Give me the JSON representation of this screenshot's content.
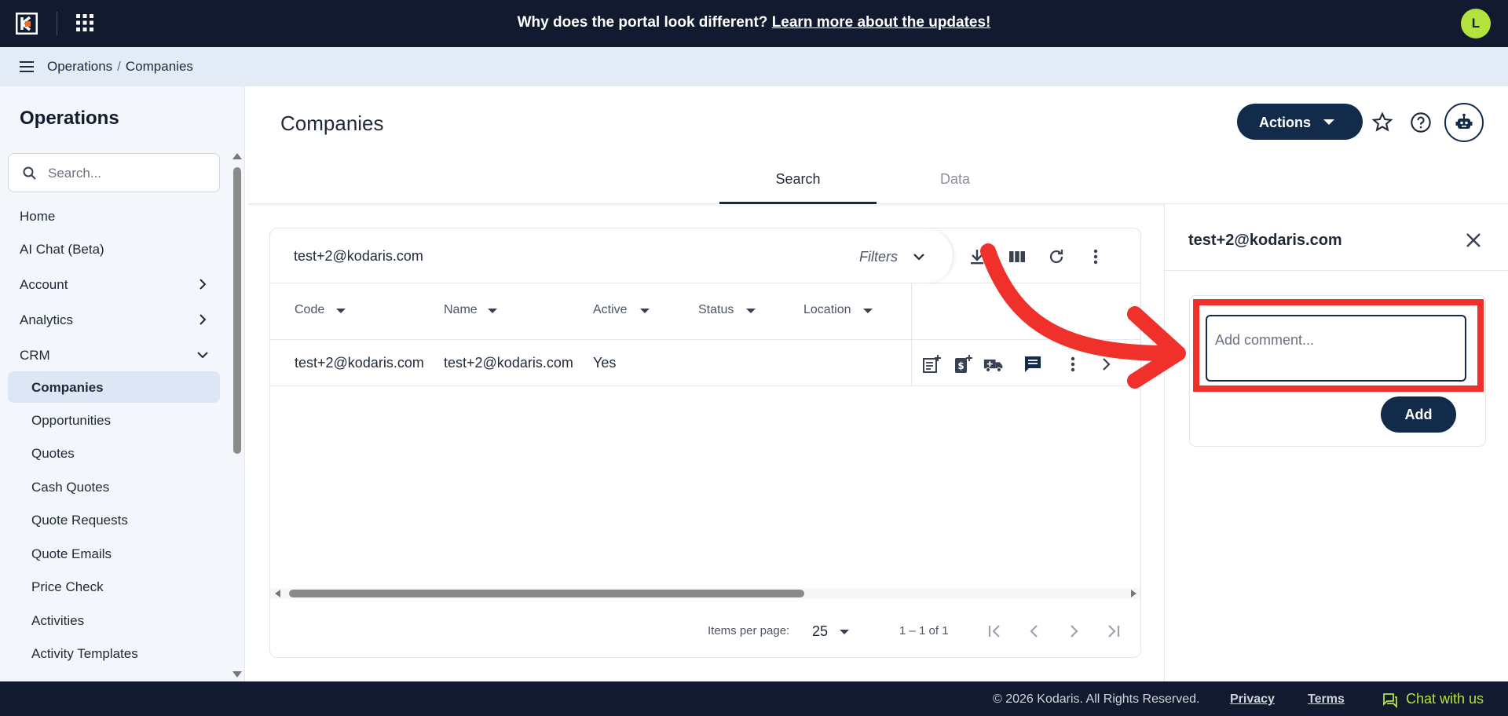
{
  "topbar": {
    "banner_text": "Why does the portal look different?",
    "banner_link": "Learn more about the updates!",
    "avatar_initial": "L"
  },
  "breadcrumb": {
    "items": [
      "Operations",
      "Companies"
    ]
  },
  "sidebar": {
    "title": "Operations",
    "search_placeholder": "Search...",
    "items": [
      {
        "label": "Home",
        "type": "top"
      },
      {
        "label": "AI Chat (Beta)",
        "type": "top"
      },
      {
        "label": "Account",
        "type": "group",
        "expanded": false
      },
      {
        "label": "Analytics",
        "type": "group",
        "expanded": false
      },
      {
        "label": "CRM",
        "type": "group",
        "expanded": true
      },
      {
        "label": "Companies",
        "type": "sub",
        "active": true
      },
      {
        "label": "Opportunities",
        "type": "sub"
      },
      {
        "label": "Quotes",
        "type": "sub"
      },
      {
        "label": "Cash Quotes",
        "type": "sub"
      },
      {
        "label": "Quote Requests",
        "type": "sub"
      },
      {
        "label": "Quote Emails",
        "type": "sub"
      },
      {
        "label": "Price Check",
        "type": "sub"
      },
      {
        "label": "Activities",
        "type": "sub"
      },
      {
        "label": "Activity Templates",
        "type": "sub"
      }
    ]
  },
  "main": {
    "title": "Companies",
    "actions_label": "Actions",
    "tabs": [
      {
        "label": "Search",
        "active": true
      },
      {
        "label": "Data",
        "active": false
      }
    ]
  },
  "grid": {
    "search_value": "test+2@kodaris.com",
    "filters_label": "Filters",
    "columns": [
      "Code",
      "Name",
      "Active",
      "Status",
      "Location"
    ],
    "rows": [
      {
        "code": "test+2@kodaris.com",
        "name": "test+2@kodaris.com",
        "active": "Yes",
        "status": "",
        "location": ""
      }
    ],
    "pager": {
      "items_per_page_label": "Items per page:",
      "page_size": "25",
      "range": "1 – 1 of 1"
    }
  },
  "panel": {
    "title": "test+2@kodaris.com",
    "comment_placeholder": "Add comment...",
    "add_label": "Add"
  },
  "footer": {
    "copyright": "© 2026 Kodaris. All Rights Reserved.",
    "privacy": "Privacy",
    "terms": "Terms",
    "chat": "Chat with us"
  },
  "colors": {
    "navy": "#111a2e",
    "primary": "#122b4a",
    "accent": "#b4e33d",
    "annotation": "#f0302b"
  }
}
